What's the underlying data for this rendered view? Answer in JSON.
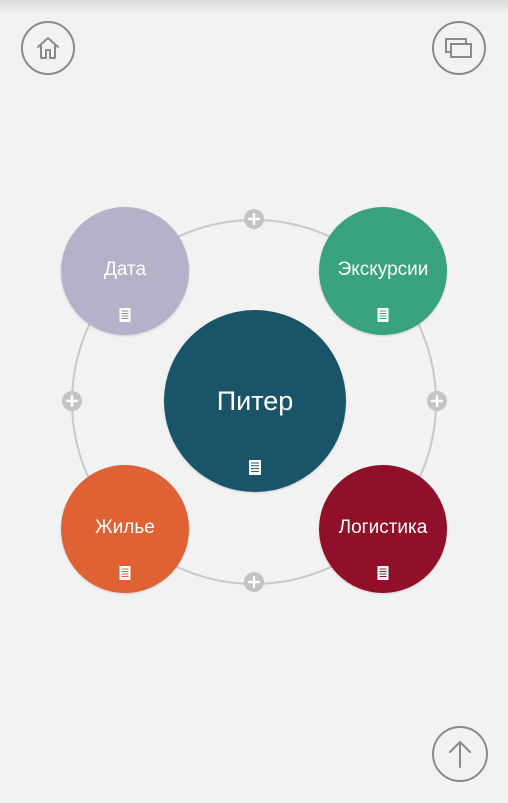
{
  "mindmap": {
    "center": {
      "label": "Питер",
      "color": "#195468"
    },
    "nodes": [
      {
        "label": "Дата",
        "color": "#b3b2c8"
      },
      {
        "label": "Экскурсии",
        "color": "#39a27f"
      },
      {
        "label": "Жилье",
        "color": "#de6234"
      },
      {
        "label": "Логистика",
        "color": "#8f1028"
      }
    ]
  },
  "icons": {
    "home": "home-icon",
    "windows": "windows-icon",
    "up": "arrow-up-icon",
    "add": "plus-icon",
    "note": "note-icon"
  },
  "colors": {
    "background": "#f2f2f2",
    "ring": "#c8c8c8",
    "button_outline": "#8a8a8a"
  }
}
